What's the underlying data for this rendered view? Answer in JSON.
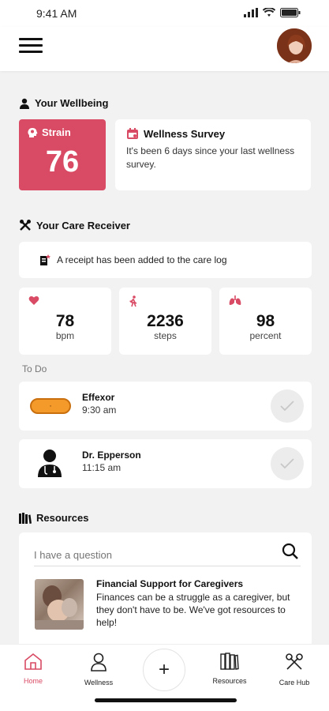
{
  "status": {
    "time": "9:41 AM"
  },
  "wellbeing": {
    "title": "Your Wellbeing",
    "strain": {
      "label": "Strain",
      "value": "76"
    },
    "survey": {
      "title": "Wellness Survey",
      "text": "It's been 6 days since your last wellness survey."
    }
  },
  "care_receiver": {
    "title": "Your Care Receiver",
    "notice": "A receipt has been added to the care log",
    "vitals": [
      {
        "value": "78",
        "unit": "bpm",
        "icon": "heart-icon"
      },
      {
        "value": "2236",
        "unit": "steps",
        "icon": "walking-icon"
      },
      {
        "value": "98",
        "unit": "percent",
        "icon": "lungs-icon"
      }
    ]
  },
  "todo": {
    "label": "To Do",
    "items": [
      {
        "name": "Effexor",
        "time": "9:30 am",
        "icon": "pill-icon"
      },
      {
        "name": "Dr. Epperson",
        "time": "11:15 am",
        "icon": "doctor-icon"
      }
    ]
  },
  "resources": {
    "title": "Resources",
    "search_placeholder": "I have a question",
    "article": {
      "title": "Financial Support for Caregivers",
      "text": "Finances can be a struggle as a caregiver, but they don't have to be. We've got resources to help!"
    }
  },
  "nav": {
    "home": "Home",
    "wellness": "Wellness",
    "add": "+",
    "resources": "Resources",
    "care_hub": "Care Hub"
  },
  "colors": {
    "accent": "#d94a64",
    "pill": "#f39a2a"
  }
}
